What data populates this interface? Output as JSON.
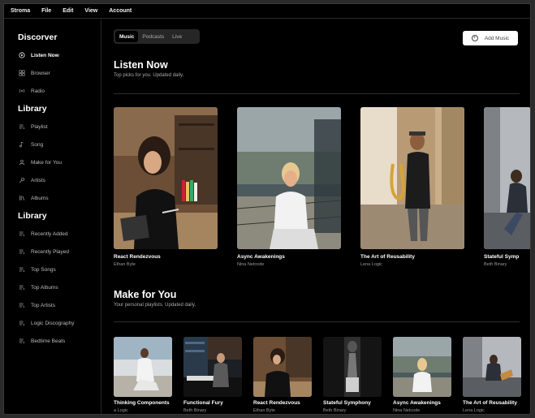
{
  "menu": [
    "Stroma",
    "File",
    "Edit",
    "View",
    "Account"
  ],
  "sidebar": {
    "discover_heading": "Discorver",
    "discover": [
      {
        "label": "Listen Now",
        "icon": "play-circle-icon"
      },
      {
        "label": "Browser",
        "icon": "grid-icon"
      },
      {
        "label": "Radio",
        "icon": "radio-icon"
      }
    ],
    "library_heading": "Library",
    "library": [
      {
        "label": "Playlist",
        "icon": "playlist-icon"
      },
      {
        "label": "Song",
        "icon": "music-note-icon"
      },
      {
        "label": "Make for You",
        "icon": "user-icon"
      },
      {
        "label": "Artists",
        "icon": "microphone-icon"
      },
      {
        "label": "Albums",
        "icon": "library-icon"
      }
    ],
    "library2_heading": "Library",
    "library2": [
      {
        "label": "Recently Added",
        "icon": "playlist-icon"
      },
      {
        "label": "Recently Played",
        "icon": "playlist-icon"
      },
      {
        "label": "Top Songs",
        "icon": "playlist-icon"
      },
      {
        "label": "Top Albums",
        "icon": "playlist-icon"
      },
      {
        "label": "Top Artists",
        "icon": "playlist-icon"
      },
      {
        "label": "Logic Discography",
        "icon": "playlist-icon"
      },
      {
        "label": "Bedtime Beats",
        "icon": "playlist-icon"
      }
    ]
  },
  "tabs": {
    "music": "Music",
    "podcasts": "Podcasts",
    "live": "Live"
  },
  "add_music": "Add Music",
  "listen_now": {
    "title": "Listen Now",
    "subtitle": "Top picks for you. Updated daily.",
    "items": [
      {
        "title": "React Rendezvous",
        "artist": "Ethan Byte"
      },
      {
        "title": "Async Awakenings",
        "artist": "Nina Netcode"
      },
      {
        "title": "The Art of Reusability",
        "artist": "Lena Logic"
      },
      {
        "title": "Stateful Symp",
        "artist": "Beth Binary"
      }
    ]
  },
  "made_for_you": {
    "title": "Make for You",
    "subtitle": "Your personal playlists. Updated daily.",
    "items": [
      {
        "title": "Thinking Components",
        "artist": "a Logic"
      },
      {
        "title": "Functional Fury",
        "artist": "Beth Binary"
      },
      {
        "title": "React Rendezvous",
        "artist": "Ethan Byte"
      },
      {
        "title": "Stateful Symphony",
        "artist": "Beth Binary"
      },
      {
        "title": "Async Awakenings",
        "artist": "Nina Netcode"
      },
      {
        "title": "The Art of Reusability",
        "artist": "Lena Logic"
      }
    ]
  }
}
